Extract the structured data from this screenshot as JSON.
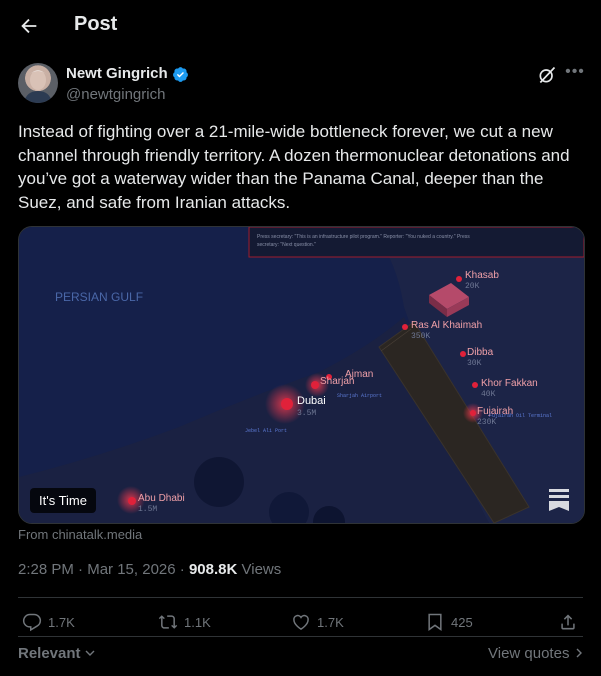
{
  "header": {
    "title": "Post",
    "back_icon": "arrow-left-icon"
  },
  "author": {
    "name": "Newt Gingrich",
    "handle": "@newtgingrich",
    "verified_color": "#1d9bf0"
  },
  "tweet": {
    "text": "Instead of fighting over a 21-mile-wide bottleneck forever, we cut a new channel through friendly territory. A dozen thermonuclear detonations and you’ve got a waterway wider than the Panama Canal, deeper than the Suez, and safe from Iranian attacks."
  },
  "media": {
    "overlay_label": "It's Time",
    "source": "From chinatalk.media",
    "map": {
      "caption": "Press secretary: \"This is an infrastructure pilot program.\" Reporter: \"You nuked a country.\" Press secretary: \"Next question.\"",
      "sea_label": "PERSIAN GULF",
      "cities": [
        {
          "name": "Khasab",
          "pop": "20K"
        },
        {
          "name": "Ras Al Khaimah",
          "pop": "350K"
        },
        {
          "name": "Dibba",
          "pop": "30K"
        },
        {
          "name": "Ajman",
          "pop": ""
        },
        {
          "name": "Sharjah",
          "pop": ""
        },
        {
          "name": "Dubai",
          "pop": "3.5M"
        },
        {
          "name": "Khor Fakkan",
          "pop": "40K"
        },
        {
          "name": "Fujairah",
          "pop": "230K"
        },
        {
          "name": "Abu Dhabi",
          "pop": "1.5M"
        }
      ],
      "ports": [
        "Jebel Ali Port",
        "Sharjah Airport",
        "Fujairah Oil Terminal"
      ],
      "accent_color": "#e0213a"
    }
  },
  "meta": {
    "time": "2:28 PM",
    "date": "Mar 15, 2026",
    "views_count": "908.8K",
    "views_label": "Views"
  },
  "actions": {
    "replies": "1.7K",
    "reposts": "1.1K",
    "likes": "1.7K",
    "bookmarks": "425"
  },
  "footer": {
    "sort_label": "Relevant",
    "view_quotes": "View quotes"
  }
}
